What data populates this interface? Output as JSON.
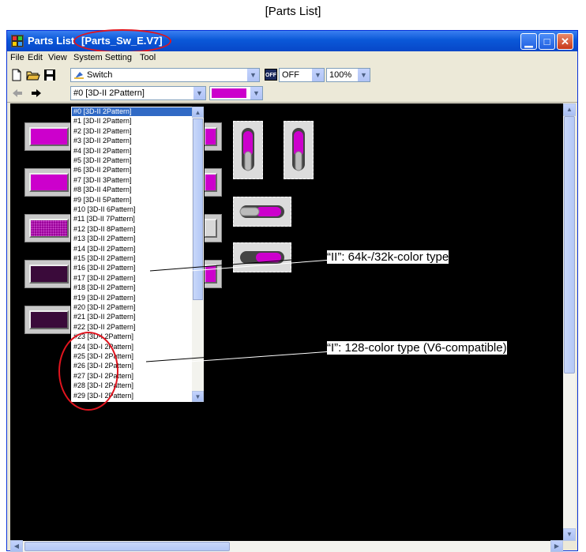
{
  "caption": "[Parts List]",
  "window": {
    "title": "Parts List",
    "document": "[Parts_Sw_E.V7]",
    "buttons": {
      "minimize": "▁",
      "maximize": "□",
      "close": "✕"
    }
  },
  "menu": [
    "File",
    "Edit",
    "View",
    "System Setting",
    "Tool"
  ],
  "toolbar1": {
    "category_combo": "Switch",
    "state_icon": "OFF",
    "state_combo": "OFF",
    "zoom_combo": "100%"
  },
  "toolbar2": {
    "part_combo": "#0 [3D-II 2Pattern]",
    "color_value": "#cc00cc"
  },
  "part_list": {
    "items": [
      "#0 [3D-II 2Pattern]",
      "#1 [3D-II 2Pattern]",
      "#2 [3D-II 2Pattern]",
      "#3 [3D-II 2Pattern]",
      "#4 [3D-II 2Pattern]",
      "#5 [3D-II 2Pattern]",
      "#6 [3D-II 2Pattern]",
      "#7 [3D-II 3Pattern]",
      "#8 [3D-II 4Pattern]",
      "#9 [3D-II 5Pattern]",
      "#10 [3D-II 6Pattern]",
      "#11 [3D-II 7Pattern]",
      "#12 [3D-II 8Pattern]",
      "#13 [3D-II 2Pattern]",
      "#14 [3D-II 2Pattern]",
      "#15 [3D-II 2Pattern]",
      "#16 [3D-II 2Pattern]",
      "#17 [3D-II 2Pattern]",
      "#18 [3D-II 2Pattern]",
      "#19 [3D-II 2Pattern]",
      "#20 [3D-II 2Pattern]",
      "#21 [3D-II 2Pattern]",
      "#22 [3D-II 2Pattern]",
      "#23 [3D-I 2Pattern]",
      "#24 [3D-I 2Pattern]",
      "#25 [3D-I 2Pattern]",
      "#26 [3D-I 2Pattern]",
      "#27 [3D-I 2Pattern]",
      "#28 [3D-I 2Pattern]",
      "#29 [3D-I 2Pattern]"
    ],
    "selected_index": 0
  },
  "annotations": {
    "type_ii": "“II”: 64k-/32k-color type",
    "type_i": "“I”: 128-color type (V6-compatible)"
  },
  "colors": {
    "accent_magenta": "#cc00cc",
    "dark_purple": "#3a0a3a",
    "highlight_red": "#e0141e",
    "selection_blue": "#316ac5"
  }
}
